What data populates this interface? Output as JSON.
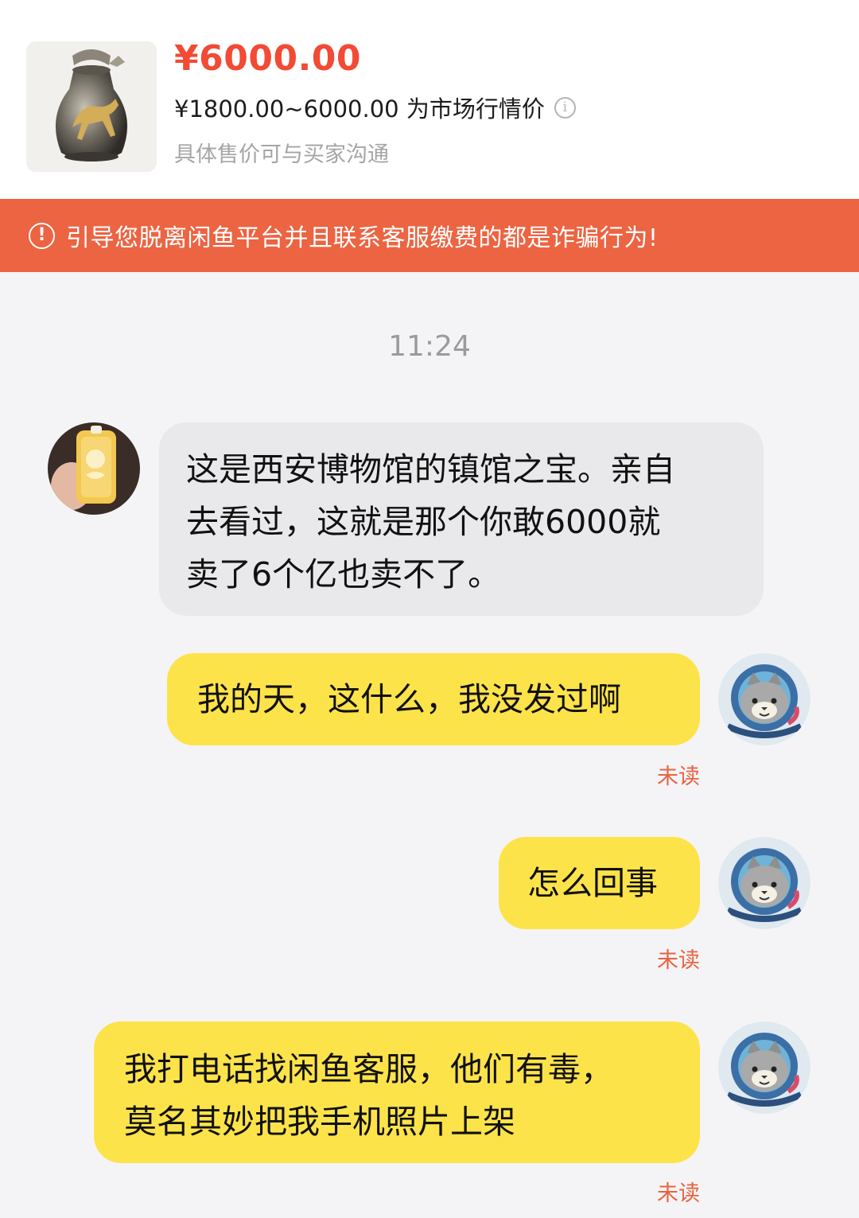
{
  "product": {
    "price": "¥6000.00",
    "price_range": "¥1800.00~6000.00 为市场行情价",
    "price_note": "具体售价可与买家沟通",
    "info_icon": "info-icon"
  },
  "warning": {
    "icon": "alert-circle-icon",
    "text": "引导您脱离闲鱼平台并且联系客服缴费的都是诈骗行为!"
  },
  "chat": {
    "timestamp": "11:24",
    "messages": [
      {
        "sender": "buyer",
        "lines": [
          "这是西安博物馆的镇馆之宝。亲自",
          "去看过，这就是那个你敢6000就",
          "卖了6个亿也卖不了。"
        ]
      },
      {
        "sender": "me",
        "text": "我的天，这什么，我没发过啊",
        "status": "未读"
      },
      {
        "sender": "me",
        "text": "怎么回事",
        "status": "未读"
      },
      {
        "sender": "me",
        "lines": [
          "我打电话找闲鱼客服，他们有毒，",
          "莫名其妙把我手机照片上架"
        ],
        "status": "未读"
      }
    ]
  },
  "colors": {
    "accent_red": "#f24a35",
    "warning_bg": "#ec6442",
    "outgoing_bubble": "#fde34a",
    "incoming_bubble": "#e9e9ec",
    "unread_status": "#e96240"
  }
}
